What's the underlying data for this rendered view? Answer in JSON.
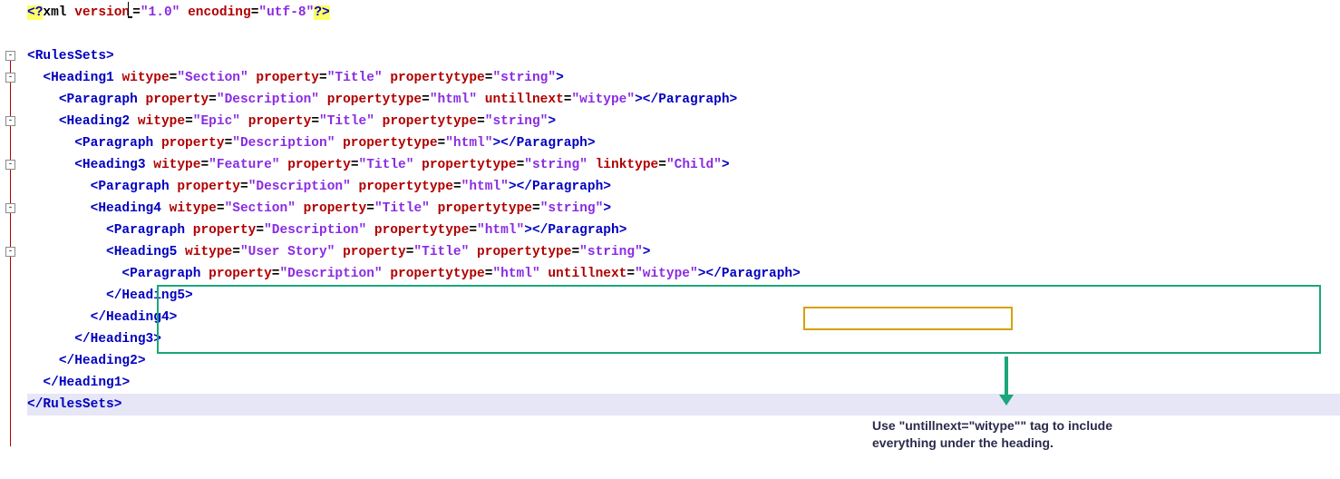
{
  "xml_decl": {
    "open": "<?",
    "xml": "xml",
    "attrs": [
      {
        "name": "version",
        "value": "\"1.0\""
      },
      {
        "name": "encoding",
        "value": "\"utf-8\""
      }
    ],
    "close": "?>"
  },
  "lines": [
    {
      "indent": 0,
      "kind": "open",
      "tag": "RulesSets",
      "attrs": []
    },
    {
      "indent": 1,
      "kind": "open",
      "tag": "Heading1",
      "attrs": [
        {
          "name": "witype",
          "value": "\"Section\""
        },
        {
          "name": "property",
          "value": "\"Title\""
        },
        {
          "name": "propertytype",
          "value": "\"string\""
        }
      ]
    },
    {
      "indent": 2,
      "kind": "pair",
      "tag": "Paragraph",
      "attrs": [
        {
          "name": "property",
          "value": "\"Description\""
        },
        {
          "name": "propertytype",
          "value": "\"html\""
        },
        {
          "name": "untillnext",
          "value": "\"witype\""
        }
      ]
    },
    {
      "indent": 2,
      "kind": "open",
      "tag": "Heading2",
      "attrs": [
        {
          "name": "witype",
          "value": "\"Epic\""
        },
        {
          "name": "property",
          "value": "\"Title\""
        },
        {
          "name": "propertytype",
          "value": "\"string\""
        }
      ]
    },
    {
      "indent": 3,
      "kind": "pair",
      "tag": "Paragraph",
      "attrs": [
        {
          "name": "property",
          "value": "\"Description\""
        },
        {
          "name": "propertytype",
          "value": "\"html\""
        }
      ]
    },
    {
      "indent": 3,
      "kind": "open",
      "tag": "Heading3",
      "attrs": [
        {
          "name": "witype",
          "value": "\"Feature\""
        },
        {
          "name": "property",
          "value": "\"Title\""
        },
        {
          "name": "propertytype",
          "value": "\"string\""
        },
        {
          "name": "linktype",
          "value": "\"Child\""
        }
      ]
    },
    {
      "indent": 4,
      "kind": "pair",
      "tag": "Paragraph",
      "attrs": [
        {
          "name": "property",
          "value": "\"Description\""
        },
        {
          "name": "propertytype",
          "value": "\"html\""
        }
      ]
    },
    {
      "indent": 4,
      "kind": "open",
      "tag": "Heading4",
      "attrs": [
        {
          "name": "witype",
          "value": "\"Section\""
        },
        {
          "name": "property",
          "value": "\"Title\""
        },
        {
          "name": "propertytype",
          "value": "\"string\""
        }
      ]
    },
    {
      "indent": 5,
      "kind": "pair",
      "tag": "Paragraph",
      "attrs": [
        {
          "name": "property",
          "value": "\"Description\""
        },
        {
          "name": "propertytype",
          "value": "\"html\""
        }
      ]
    },
    {
      "indent": 5,
      "kind": "open",
      "tag": "Heading5",
      "attrs": [
        {
          "name": "witype",
          "value": "\"User Story\""
        },
        {
          "name": "property",
          "value": "\"Title\""
        },
        {
          "name": "propertytype",
          "value": "\"string\""
        }
      ]
    },
    {
      "indent": 6,
      "kind": "pair",
      "tag": "Paragraph",
      "attrs": [
        {
          "name": "property",
          "value": "\"Description\""
        },
        {
          "name": "propertytype",
          "value": "\"html\""
        },
        {
          "name": "untillnext",
          "value": "\"witype\""
        }
      ]
    },
    {
      "indent": 5,
      "kind": "close",
      "tag": "Heading5",
      "attrs": []
    },
    {
      "indent": 4,
      "kind": "close",
      "tag": "Heading4",
      "attrs": []
    },
    {
      "indent": 3,
      "kind": "close",
      "tag": "Heading3",
      "attrs": []
    },
    {
      "indent": 2,
      "kind": "close",
      "tag": "Heading2",
      "attrs": []
    },
    {
      "indent": 1,
      "kind": "close",
      "tag": "Heading1",
      "attrs": []
    },
    {
      "indent": 0,
      "kind": "close",
      "tag": "RulesSets",
      "attrs": []
    }
  ],
  "fold_boxes_at_lines": [
    2,
    3,
    5,
    7,
    9,
    11
  ],
  "annotation": {
    "text_line1": "Use \"untillnext=\"witype\"\" tag to include",
    "text_line2": "everything under the heading."
  }
}
